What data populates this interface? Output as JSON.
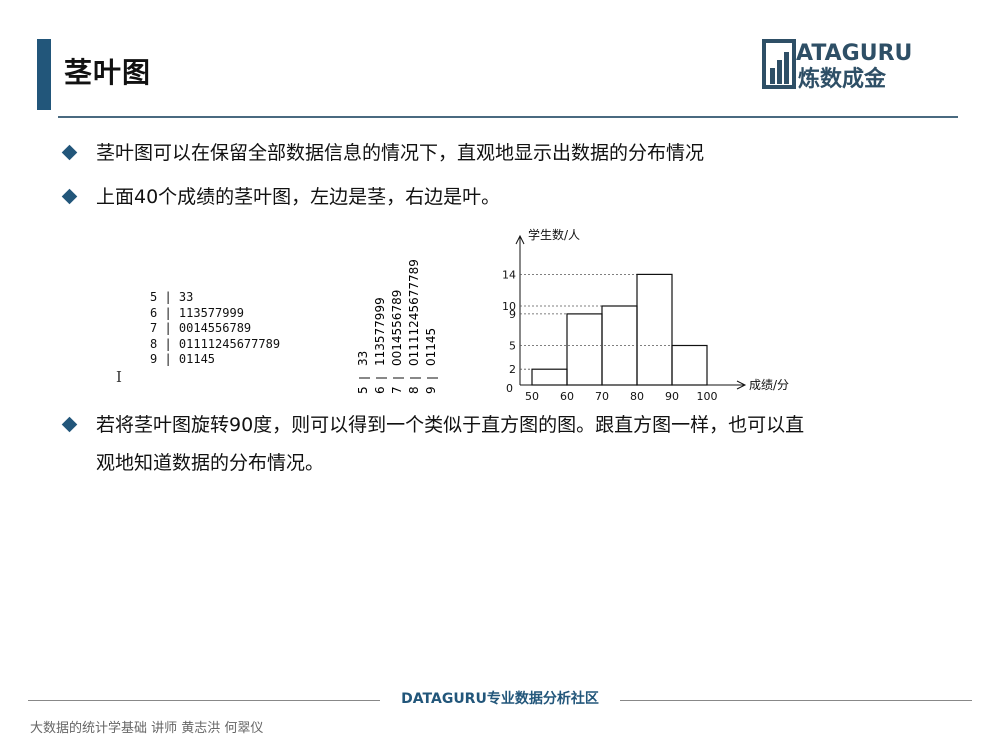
{
  "slide": {
    "title": "茎叶图",
    "logo": {
      "brand_text": "ATAGURU",
      "brand_letter": "D",
      "subtitle": "炼数成金"
    },
    "bullets": [
      "茎叶图可以在保留全部数据信息的情况下，直观地显示出数据的分布情况",
      "上面40个成绩的茎叶图，左边是茎，右边是叶。",
      "若将茎叶图旋转90度，则可以得到一个类似于直方图的图。跟直方图一样，也可以直",
      "观地知道数据的分布情况。"
    ],
    "cursor_glyph": "I"
  },
  "stem_leaf": {
    "rows": [
      {
        "stem": "5",
        "leaves": "33"
      },
      {
        "stem": "6",
        "leaves": "113577999"
      },
      {
        "stem": "7",
        "leaves": "0014556789"
      },
      {
        "stem": "8",
        "leaves": "01111245677789"
      },
      {
        "stem": "9",
        "leaves": "01145"
      }
    ]
  },
  "chart_data": {
    "type": "bar",
    "categories": [
      "50",
      "60",
      "70",
      "80",
      "90",
      "100"
    ],
    "bins": [
      [
        50,
        60
      ],
      [
        60,
        70
      ],
      [
        70,
        80
      ],
      [
        80,
        90
      ],
      [
        90,
        100
      ]
    ],
    "values": [
      2,
      9,
      10,
      14,
      5
    ],
    "xlabel": "成绩/分",
    "ylabel": "学生数/人",
    "y_ticks": [
      "2",
      "5",
      "9",
      "10",
      "14"
    ],
    "origin_label": "0",
    "xlim": [
      50,
      100
    ],
    "ylim": [
      0,
      16
    ],
    "grid": false,
    "dashed_guides": true
  },
  "footer": {
    "center": "DATAGURU专业数据分析社区",
    "left": "大数据的统计学基础  讲师 黄志洪 何翠仪"
  }
}
